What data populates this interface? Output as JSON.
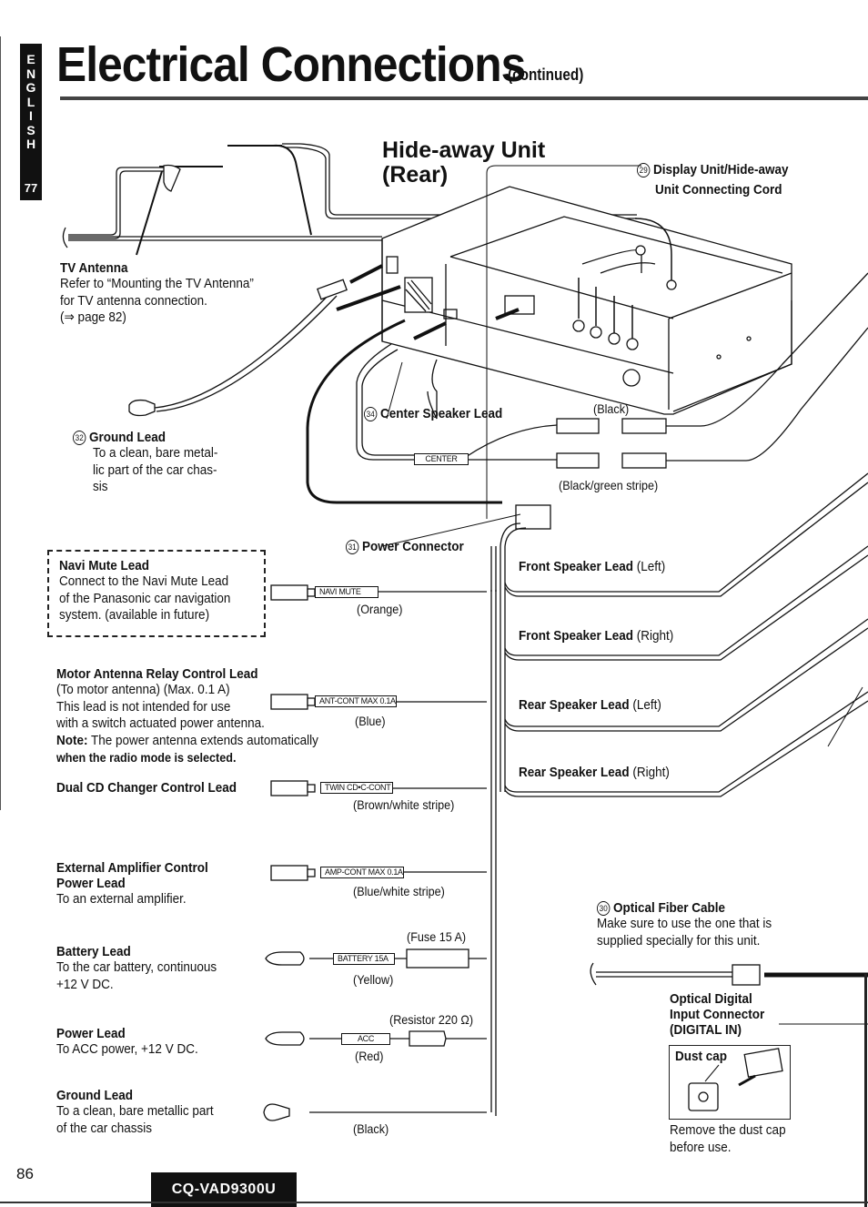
{
  "side_tab": {
    "language_letters": [
      "E",
      "N",
      "G",
      "L",
      "I",
      "S",
      "H"
    ],
    "section_number": "77"
  },
  "header": {
    "title": "Electrical Connections",
    "subtitle": "(continued)"
  },
  "hideaway": {
    "title_line1": "Hide-away Unit",
    "title_line2": "(Rear)"
  },
  "items": {
    "connecting_cord": {
      "number": "29",
      "label_line1": "Display Unit/Hide-away",
      "label_line2": "Unit Connecting Cord"
    },
    "tv_antenna": {
      "title": "TV Antenna",
      "lines": [
        "Refer to “Mounting the TV Antenna”",
        "for TV antenna connection.",
        "(⇒ page 82)"
      ]
    },
    "ground_lead_32": {
      "number": "32",
      "title": "Ground Lead",
      "lines": [
        "To a clean, bare metal-",
        "lic part of the car chas-",
        "sis"
      ]
    },
    "center_speaker": {
      "number": "34",
      "title": "Center Speaker Lead",
      "tag": "CENTER",
      "color_top": "(Black)",
      "color_bottom": "(Black/green stripe)"
    },
    "power_connector": {
      "number": "31",
      "title": "Power Connector"
    },
    "navi_mute": {
      "title": "Navi Mute Lead",
      "lines": [
        "Connect to the Navi Mute Lead",
        "of the Panasonic car navigation",
        "system. (available in future)"
      ],
      "tag": "NAVI MUTE",
      "color": "(Orange)"
    },
    "motor_antenna": {
      "title": "Motor Antenna Relay Control Lead",
      "lines": [
        "(To motor antenna) (Max. 0.1 A)",
        "This lead is not intended for use",
        "with a switch actuated power antenna."
      ],
      "note_label": "Note:",
      "note_text": "The power antenna extends automatically",
      "note_bold": "when the radio mode is selected.",
      "tag": "ANT-CONT MAX 0.1A",
      "color": "(Blue)"
    },
    "dual_cd": {
      "title": "Dual CD Changer Control Lead",
      "tag": "TWIN CD•C-CONT",
      "color": "(Brown/white stripe)"
    },
    "ext_amp": {
      "title_line1": "External Amplifier Control",
      "title_line2": "Power Lead",
      "lines": [
        "To an external amplifier."
      ],
      "tag": "AMP-CONT MAX 0.1A",
      "color": "(Blue/white stripe)"
    },
    "battery": {
      "title": "Battery Lead",
      "lines": [
        "To the car battery, continuous",
        "+12 V DC."
      ],
      "tag": "BATTERY 15A",
      "fuse": "(Fuse 15 A)",
      "color": "(Yellow)"
    },
    "power_lead": {
      "title": "Power Lead",
      "lines": [
        "To ACC power, +12 V DC."
      ],
      "tag": "ACC",
      "resistor": "(Resistor 220 Ω)",
      "color": "(Red)"
    },
    "ground_lead": {
      "title": "Ground Lead",
      "lines": [
        "To a clean, bare metallic part",
        "of the car chassis"
      ],
      "color": "(Black)"
    },
    "speakers": [
      {
        "title": "Front Speaker Lead",
        "side": "(Left)"
      },
      {
        "title": "Front Speaker Lead",
        "side": "(Right)"
      },
      {
        "title": "Rear Speaker Lead",
        "side": "(Left)"
      },
      {
        "title": "Rear Speaker Lead",
        "side": "(Right)"
      }
    ],
    "optical": {
      "number": "30",
      "title": "Optical Fiber Cable",
      "lines": [
        "Make sure to use the one that is",
        "supplied specially for this unit."
      ],
      "connector_line1": "Optical Digital",
      "connector_line2": "Input Connector",
      "connector_line3": "(DIGITAL IN)",
      "dust_cap_label": "Dust cap",
      "dust_note": [
        "Remove the dust cap",
        "before use."
      ]
    }
  },
  "footer": {
    "page_number": "86",
    "model": "CQ-VAD9300U"
  }
}
